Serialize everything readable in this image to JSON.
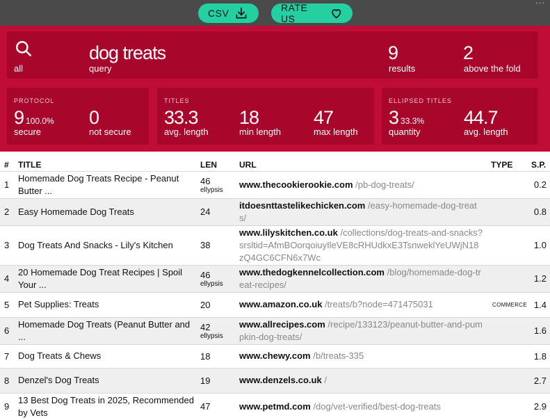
{
  "toolbar": {
    "csv_label": "CSV",
    "rate_label": "RATE US",
    "dots": "•••"
  },
  "summary": {
    "scope_label": "all",
    "query_value": "dog treats",
    "query_label": "query",
    "results_value": "9",
    "results_label": "results",
    "fold_value": "2",
    "fold_label": "above the fold"
  },
  "protocol": {
    "caption": "PROTOCOL",
    "secure_value": "9",
    "secure_pct": "100.0%",
    "secure_label": "secure",
    "not_secure_value": "0",
    "not_secure_label": "not secure"
  },
  "titles": {
    "caption": "TITLES",
    "avg_value": "33.3",
    "avg_label": "avg. length",
    "min_value": "18",
    "min_label": "min length",
    "max_value": "47",
    "max_label": "max length"
  },
  "ellipsed": {
    "caption": "ELLIPSED TITLES",
    "qty_value": "3",
    "qty_pct": "33.3%",
    "qty_label": "quantity",
    "avg_value": "44.7",
    "avg_label": "avg. length"
  },
  "table": {
    "headers": {
      "num": "#",
      "title": "TITLE",
      "len": "LEN",
      "url": "URL",
      "type": "TYPE",
      "sp": "S.P."
    },
    "rows": [
      {
        "num": "1",
        "title": "Homemade Dog Treats Recipe - Peanut Butter ...",
        "len": "46",
        "note": "ellypsis",
        "domain": "www.thecookierookie.com",
        "path": "/pb-dog-treats/",
        "type": "",
        "sp": "0.2"
      },
      {
        "num": "2",
        "title": "Easy Homemade Dog Treats",
        "len": "24",
        "note": "",
        "domain": "itdoesnttastelikechicken.com",
        "path": "/easy-homemade-dog-treats/",
        "type": "",
        "sp": "0.8"
      },
      {
        "num": "3",
        "title": "Dog Treats And Snacks - Lily's Kitchen",
        "len": "38",
        "note": "",
        "domain": "www.lilyskitchen.co.uk",
        "path": "/collections/dog-treats-and-snacks?srsltid=AfmBOorqoiuyIleVE8cRHUdkxE3TsnweklYeUWjN18zQ4GC6CFN6x7Wc",
        "type": "",
        "sp": "1.0"
      },
      {
        "num": "4",
        "title": "20 Homemade Dog Treat Recipes | Spoil Your ...",
        "len": "46",
        "note": "ellypsis",
        "domain": "www.thedogkennelcollection.com",
        "path": "/blog/homemade-dog-treat-recipes/",
        "type": "",
        "sp": "1.2"
      },
      {
        "num": "5",
        "title": "Pet Supplies: Treats",
        "len": "20",
        "note": "",
        "domain": "www.amazon.co.uk",
        "path": "/treats/b?node=471475031",
        "type": "COMMERCE",
        "sp": "1.4"
      },
      {
        "num": "6",
        "title": "Homemade Dog Treats (Peanut Butter and ...",
        "len": "42",
        "note": "ellypsis",
        "domain": "www.allrecipes.com",
        "path": "/recipe/133123/peanut-butter-and-pumpkin-dog-treats/",
        "type": "",
        "sp": "1.6"
      },
      {
        "num": "7",
        "title": "Dog Treats & Chews",
        "len": "18",
        "note": "",
        "domain": "www.chewy.com",
        "path": "/b/treats-335",
        "type": "",
        "sp": "1.8"
      },
      {
        "num": "8",
        "title": "Denzel's Dog Treats",
        "len": "19",
        "note": "",
        "domain": "www.denzels.co.uk",
        "path": "/",
        "type": "",
        "sp": "2.7"
      },
      {
        "num": "9",
        "title": "13 Best Dog Treats in 2025, Recommended by Vets",
        "len": "47",
        "note": "",
        "domain": "www.petmd.com",
        "path": "/dog/vet-verified/best-dog-treats",
        "type": "",
        "sp": "2.9"
      }
    ]
  }
}
